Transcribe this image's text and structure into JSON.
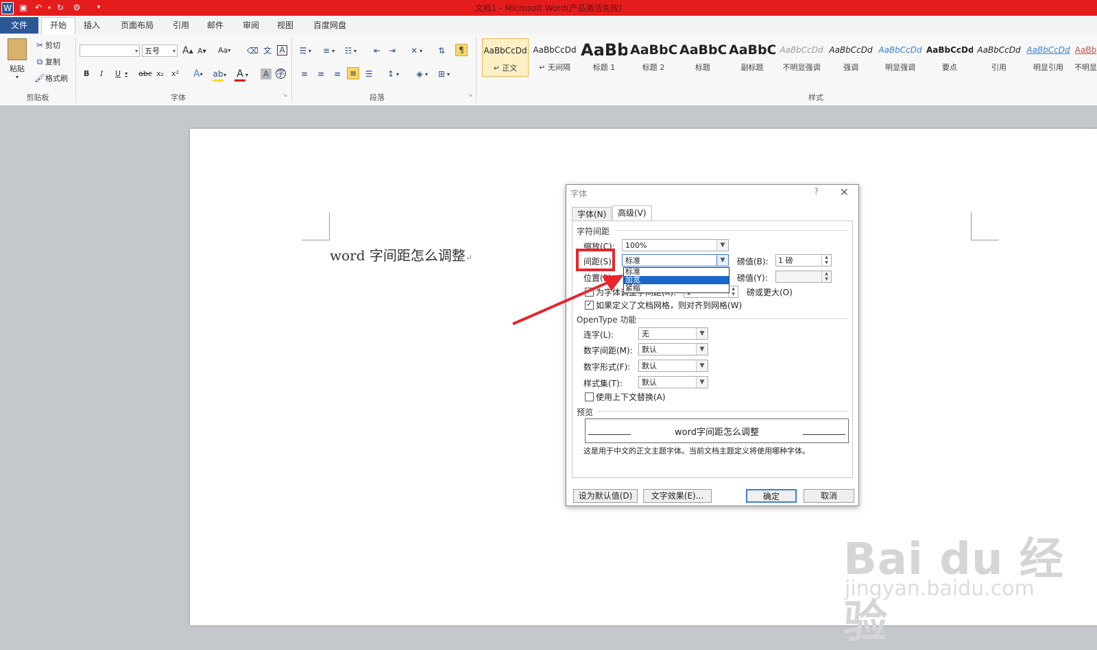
{
  "window": {
    "title": "文档1 - Microsoft Word(产品激活失败)"
  },
  "tabs": [
    "文件",
    "开始",
    "插入",
    "页面布局",
    "引用",
    "邮件",
    "审阅",
    "视图",
    "百度网盘"
  ],
  "ribbon": {
    "clipboard": {
      "paste": "粘贴",
      "cut": "剪切",
      "copy": "复制",
      "format_painter": "格式刷",
      "group": "剪贴板"
    },
    "font": {
      "font_name": "",
      "font_size": "五号",
      "group": "字体",
      "grow": "A",
      "shrink": "A",
      "case": "Aa",
      "bold": "B",
      "italic": "I",
      "underline": "U",
      "strike": "abc",
      "sub": "x₂",
      "sup": "x²"
    },
    "paragraph": {
      "group": "段落"
    },
    "styles": {
      "group": "样式",
      "items": [
        {
          "preview": "AaBbCcDd",
          "name": "↵ 正文"
        },
        {
          "preview": "AaBbCcDd",
          "name": "↵ 无间隔"
        },
        {
          "preview": "AaBb",
          "name": "标题 1"
        },
        {
          "preview": "AaBbC",
          "name": "标题 2"
        },
        {
          "preview": "AaBbC",
          "name": "标题"
        },
        {
          "preview": "AaBbC",
          "name": "副标题"
        },
        {
          "preview": "AaBbCcDd",
          "name": "不明显强调"
        },
        {
          "preview": "AaBbCcDd",
          "name": "强调"
        },
        {
          "preview": "AaBbCcDd",
          "name": "明显强调"
        },
        {
          "preview": "AaBbCcDd",
          "name": "要点"
        },
        {
          "preview": "AaBbCcDd",
          "name": "引用"
        },
        {
          "preview": "AaBbCcDd",
          "name": "明显引用"
        },
        {
          "preview": "AaBb",
          "name": "不明显"
        }
      ]
    }
  },
  "document": {
    "text": "word 字间距怎么调整",
    "para_mark": "↵"
  },
  "dialog": {
    "title": "字体",
    "help": "?",
    "tabs": [
      "字体(N)",
      "高级(V)"
    ],
    "char_spacing_section": "字符间距",
    "scale_label": "缩放(C):",
    "scale_value": "100%",
    "spacing_label": "间距(S):",
    "spacing_value": "标准",
    "by1_label": "磅值(B):",
    "by1_value": "1 磅",
    "position_label": "位置(P):",
    "by2_label": "磅值(Y):",
    "by2_value": "",
    "kerning_label": "为字体调整字间距(K):",
    "kerning_value": "1",
    "kerning_suffix": "磅或更大(O)",
    "grid_label": "如果定义了文档网格，则对齐到网格(W)",
    "dropdown_options": [
      "标准",
      "加宽",
      "紧缩"
    ],
    "opentype_section": "OpenType 功能",
    "ligature_label": "连字(L):",
    "ligature_value": "无",
    "numspacing_label": "数字间距(M):",
    "numspacing_value": "默认",
    "numform_label": "数字形式(F):",
    "numform_value": "默认",
    "styleset_label": "样式集(T):",
    "styleset_value": "默认",
    "contextual_label": "使用上下文替换(A)",
    "preview_section": "预览",
    "preview_text": "word字间距怎么调整",
    "preview_note": "这是用于中文的正文主题字体。当前文档主题定义将使用哪种字体。",
    "btn_default": "设为默认值(D)",
    "btn_effects": "文字效果(E)...",
    "btn_ok": "确定",
    "btn_cancel": "取消"
  },
  "watermark": {
    "main": "Bai du 经验",
    "sub": "jingyan.baidu.com"
  }
}
